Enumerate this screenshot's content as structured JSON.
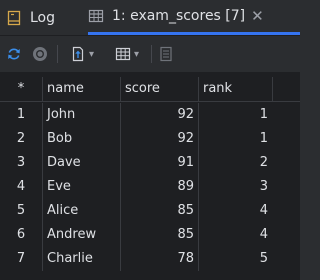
{
  "tabs": [
    {
      "label": "Log",
      "icon": "log-file-icon"
    },
    {
      "label": "1: exam_scores [7]",
      "icon": "table-icon",
      "close_glyph": "✕"
    }
  ],
  "toolbar": {
    "icons": [
      "refresh-icon",
      "stop-icon",
      "export-icon",
      "grid-layout-icon",
      "calculator-icon"
    ]
  },
  "table": {
    "corner": "*",
    "columns": [
      "name",
      "score",
      "rank"
    ],
    "rows": [
      {
        "num": "1",
        "name": "John",
        "score": "92",
        "rank": "1"
      },
      {
        "num": "2",
        "name": "Bob",
        "score": "92",
        "rank": "1"
      },
      {
        "num": "3",
        "name": "Dave",
        "score": "91",
        "rank": "2"
      },
      {
        "num": "4",
        "name": "Eve",
        "score": "89",
        "rank": "3"
      },
      {
        "num": "5",
        "name": "Alice",
        "score": "85",
        "rank": "4"
      },
      {
        "num": "6",
        "name": "Andrew",
        "score": "85",
        "rank": "4"
      },
      {
        "num": "7",
        "name": "Charlie",
        "score": "78",
        "rank": "5"
      }
    ]
  },
  "colors": {
    "background": "#2b2d30",
    "grid_background": "#1e1f22",
    "accent": "#3574f0",
    "text": "#dfe1e5"
  }
}
